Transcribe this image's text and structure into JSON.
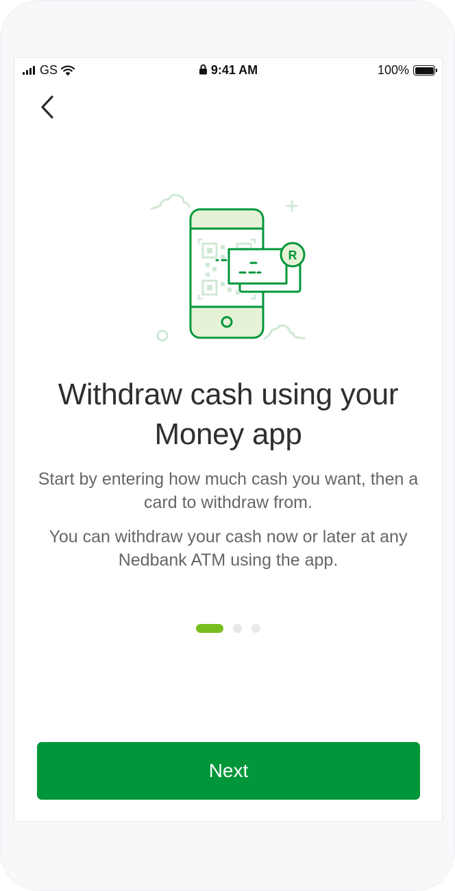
{
  "status_bar": {
    "carrier": "GS",
    "time": "9:41 AM",
    "battery": "100%"
  },
  "icons": {
    "back": "chevron-left-icon",
    "illustration": "phone-qr-cash-icon",
    "lock": "lock-icon",
    "wifi": "wifi-icon",
    "signal": "signal-icon",
    "battery": "battery-icon"
  },
  "content": {
    "title": "Withdraw cash using your Money app",
    "paragraph_1": "Start by entering how much cash you want, then a card to withdraw from.",
    "paragraph_2": "You can withdraw your cash now or later at any Nedbank ATM using the app."
  },
  "pagination": {
    "total": 3,
    "current": 1
  },
  "actions": {
    "next_label": "Next"
  },
  "colors": {
    "primary_green": "#009639",
    "accent_lime": "#78be20",
    "title_text": "#2f2f2f",
    "body_text": "#666666",
    "illustration_light": "#cfe8d4"
  }
}
